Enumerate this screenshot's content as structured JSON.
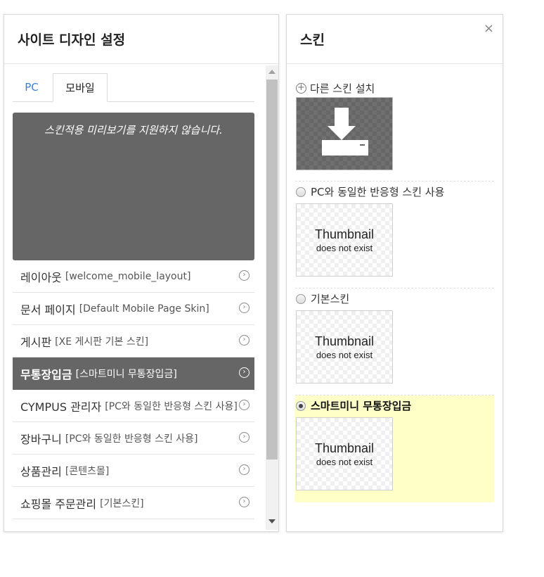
{
  "left_panel": {
    "title": "사이트 디자인 설정",
    "tabs": [
      {
        "label": "PC",
        "active": false
      },
      {
        "label": "모바일",
        "active": true
      }
    ],
    "preview_message": "스킨적용 미리보기를 지원하지 않습니다.",
    "items": [
      {
        "label": "레이아웃",
        "value": "[welcome_mobile_layout]",
        "selected": false
      },
      {
        "label": "문서 페이지",
        "value": "[Default Mobile Page Skin]",
        "selected": false
      },
      {
        "label": "게시판",
        "value": "[XE 게시판 기본 스킨]",
        "selected": false
      },
      {
        "label": "무통장입금",
        "value": "[스마트미니 무통장입금]",
        "selected": true
      },
      {
        "label": "CYMPUS 관리자",
        "value": "[PC와 동일한 반응형 스킨 사용]",
        "selected": false
      },
      {
        "label": "장바구니",
        "value": "[PC와 동일한 반응형 스킨 사용]",
        "selected": false
      },
      {
        "label": "상품관리",
        "value": "[콘텐츠몰]",
        "selected": false
      },
      {
        "label": "쇼핑몰 주문관리",
        "value": "[기본스킨]",
        "selected": false
      }
    ]
  },
  "right_panel": {
    "title": "스킨",
    "close_label": "×",
    "install_label": "다른 스킨 설치",
    "options": [
      {
        "label": "PC와 동일한 반응형 스킨 사용",
        "thumb_line1": "Thumbnail",
        "thumb_line2": "does not exist",
        "checked": false
      },
      {
        "label": "기본스킨",
        "thumb_line1": "Thumbnail",
        "thumb_line2": "does not exist",
        "checked": false
      },
      {
        "label": "스마트미니 무통장입금",
        "thumb_line1": "Thumbnail",
        "thumb_line2": "does not exist",
        "checked": true
      }
    ]
  },
  "colors": {
    "selected_row_bg": "#666666",
    "selected_skin_bg": "#ffffc8",
    "tab_pc_text": "#3b7fd6"
  }
}
